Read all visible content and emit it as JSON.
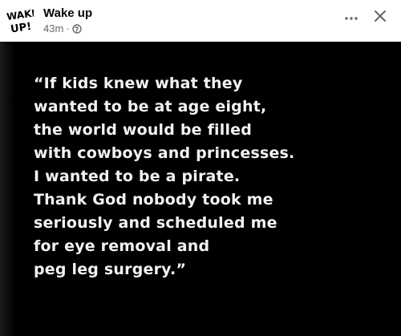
{
  "post": {
    "page_name": "Wake up",
    "avatar_text": [
      "WAKE",
      "UP!"
    ],
    "timestamp": "43m",
    "separator": "·",
    "icons": {
      "audience": "globe-icon",
      "more": "more-dots-icon",
      "close": "close-icon"
    }
  },
  "image": {
    "quote_lines": [
      "“If kids knew what they",
      "wanted to be at age eight,",
      "the world would be filled",
      "with cowboys and princesses.",
      "I wanted to be a pirate.",
      "Thank God nobody took me",
      "seriously and scheduled me",
      "for eye removal and",
      "peg leg surgery.”"
    ]
  },
  "colors": {
    "background": "#ffffff",
    "image_background": "#000000",
    "quote_text": "#f2f2f2",
    "secondary_text": "#65676b"
  }
}
